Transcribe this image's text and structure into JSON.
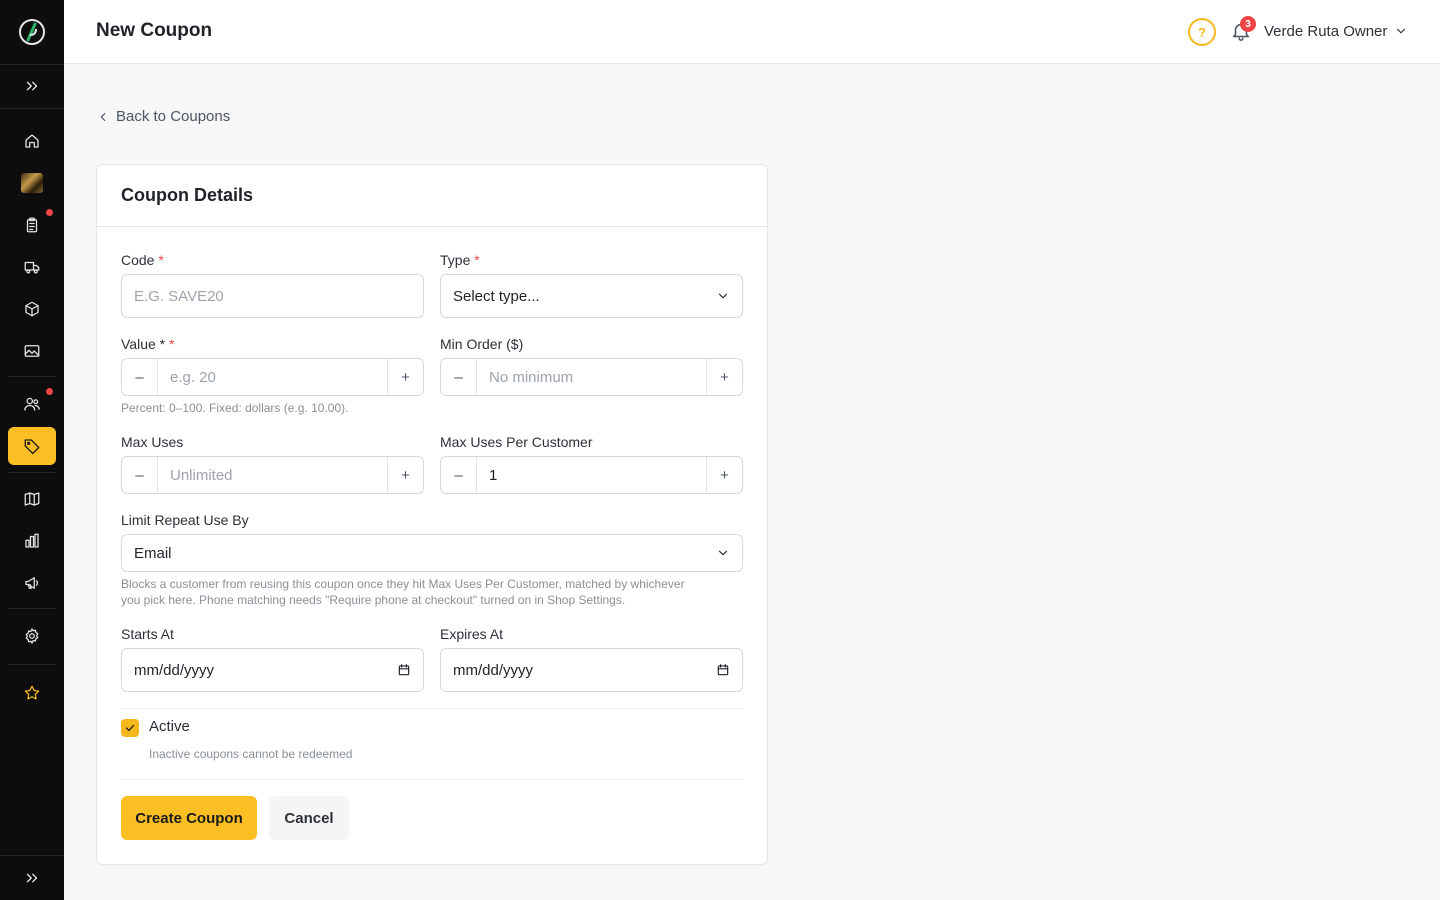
{
  "header": {
    "title": "New Coupon",
    "help_glyph": "?",
    "notification_count": "3",
    "user_name": "Verde Ruta Owner"
  },
  "sidebar": {
    "items": [
      {
        "icon": "home-icon"
      },
      {
        "icon": "store-thumbnail"
      },
      {
        "icon": "orders-icon",
        "dot": true
      },
      {
        "icon": "delivery-truck-icon"
      },
      {
        "icon": "box-icon"
      },
      {
        "icon": "image-icon"
      },
      {
        "icon": "customers-icon",
        "dot": true
      },
      {
        "icon": "tag-icon",
        "active": true
      },
      {
        "icon": "map-icon"
      },
      {
        "icon": "analytics-icon"
      },
      {
        "icon": "megaphone-icon"
      },
      {
        "icon": "gear-icon"
      },
      {
        "icon": "star-icon"
      }
    ]
  },
  "back_link": "Back to Coupons",
  "card": {
    "title": "Coupon Details",
    "code": {
      "label": "Code",
      "required": "*",
      "placeholder": "E.G. SAVE20"
    },
    "type": {
      "label": "Type",
      "required": "*",
      "selected": "Select type..."
    },
    "value": {
      "label": "Value *",
      "required": "*",
      "placeholder": "e.g. 20",
      "helper": "Percent: 0–100. Fixed: dollars (e.g. 10.00)."
    },
    "min_order": {
      "label": "Min Order ($)",
      "placeholder": "No minimum"
    },
    "max_uses": {
      "label": "Max Uses",
      "placeholder": "Unlimited"
    },
    "max_uses_per_customer": {
      "label": "Max Uses Per Customer",
      "value": "1"
    },
    "limit_repeat": {
      "label": "Limit Repeat Use By",
      "selected": "Email",
      "helper_line1": "Blocks a customer from reusing this coupon once they hit Max Uses Per Customer, matched by whichever",
      "helper_line2": "you pick here. Phone matching needs \"Require phone at checkout\" turned on in Shop Settings."
    },
    "starts_at": {
      "label": "Starts At",
      "placeholder": "mm/dd/yyyy"
    },
    "expires_at": {
      "label": "Expires At",
      "placeholder": "mm/dd/yyyy"
    },
    "active": {
      "label": "Active",
      "checked": true,
      "helper": "Inactive coupons cannot be redeemed"
    },
    "stepper_minus": "–",
    "stepper_plus": "+",
    "create_button": "Create Coupon",
    "cancel_button": "Cancel"
  },
  "colors": {
    "accent": "#fbbf24",
    "sidebar_bg": "#0d0d0d",
    "required": "#ef4444"
  }
}
